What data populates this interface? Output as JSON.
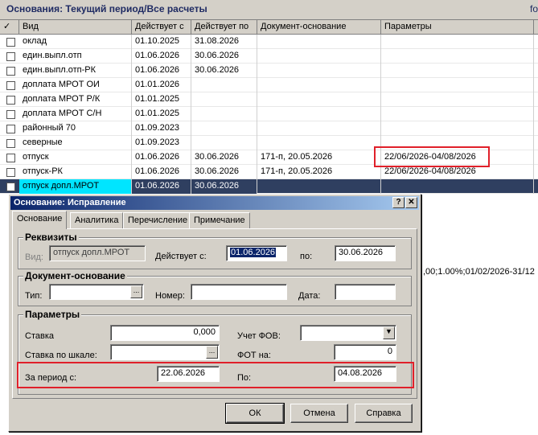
{
  "window": {
    "title": "Основания: Текущий период/Все расчеты",
    "extra": "fo"
  },
  "columns": {
    "check": "✓",
    "vid": "Вид",
    "from": "Действует с",
    "to": "Действует по",
    "doc": "Документ-основание",
    "params": "Параметры"
  },
  "rows": [
    {
      "vid": "оклад",
      "from": "01.10.2025",
      "to": "31.08.2026",
      "doc": "",
      "params": ""
    },
    {
      "vid": "един.выпл.отп",
      "from": "01.06.2026",
      "to": "30.06.2026",
      "doc": "",
      "params": ""
    },
    {
      "vid": "един.выпл.отп-РК",
      "from": "01.06.2026",
      "to": "30.06.2026",
      "doc": "",
      "params": ""
    },
    {
      "vid": "доплата МРОТ ОИ",
      "from": "01.01.2026",
      "to": "",
      "doc": "",
      "params": ""
    },
    {
      "vid": "доплата МРОТ Р/К",
      "from": "01.01.2025",
      "to": "",
      "doc": "",
      "params": ""
    },
    {
      "vid": "доплата МРОТ С/Н",
      "from": "01.01.2025",
      "to": "",
      "doc": "",
      "params": ""
    },
    {
      "vid": "районный 70",
      "from": "01.09.2023",
      "to": "",
      "doc": "",
      "params": ""
    },
    {
      "vid": "северные",
      "from": "01.09.2023",
      "to": "",
      "doc": "",
      "params": ""
    },
    {
      "vid": "отпуск",
      "from": "01.06.2026",
      "to": "30.06.2026",
      "doc": "171-п, 20.05.2026",
      "params": "22/06/2026-04/08/2026"
    },
    {
      "vid": "отпуск-РК",
      "from": "01.06.2026",
      "to": "30.06.2026",
      "doc": "171-п, 20.05.2026",
      "params": "22/06/2026-04/08/2026"
    },
    {
      "vid": "отпуск допл.МРОТ",
      "from": "01.06.2026",
      "to": "30.06.2026",
      "doc": "",
      "params": ""
    }
  ],
  "bg_right_text": ",00;1.00%;01/02/2026-31/12",
  "dialog": {
    "title": "Основание: Исправление",
    "help_btn": "?",
    "close_btn": "✕",
    "tabs": [
      "Основание",
      "Аналитика",
      "Перечисление",
      "Примечание"
    ],
    "requisites": {
      "title": "Реквизиты",
      "vid_label": "Вид:",
      "vid_value": "отпуск допл.МРОТ",
      "from_label": "Действует с:",
      "from_value": "01.06.2026",
      "to_label": "по:",
      "to_value": "30.06.2026"
    },
    "document": {
      "title": "Документ-основание",
      "type_label": "Тип:",
      "type_value": "",
      "type_btn": "...",
      "number_label": "Номер:",
      "number_value": "",
      "date_label": "Дата:",
      "date_value": ""
    },
    "params": {
      "title": "Параметры",
      "rate_label": "Ставка",
      "rate_value": "0,000",
      "fov_label": "Учет ФОВ:",
      "fov_value": "",
      "scale_label": "Ставка по шкале:",
      "scale_value": "",
      "scale_btn": "...",
      "fot_label": "ФОТ на:",
      "fot_value": "0",
      "period_from_label": "За период с:",
      "period_from_value": "22.06.2026",
      "period_to_label": "По:",
      "period_to_value": "04.08.2026"
    },
    "buttons": {
      "ok": "ОК",
      "cancel": "Отмена",
      "help": "Справка"
    }
  },
  "colors": {
    "highlight": "#e0202a",
    "selection": "#2f3f60",
    "name_cell": "#00e5ff"
  }
}
